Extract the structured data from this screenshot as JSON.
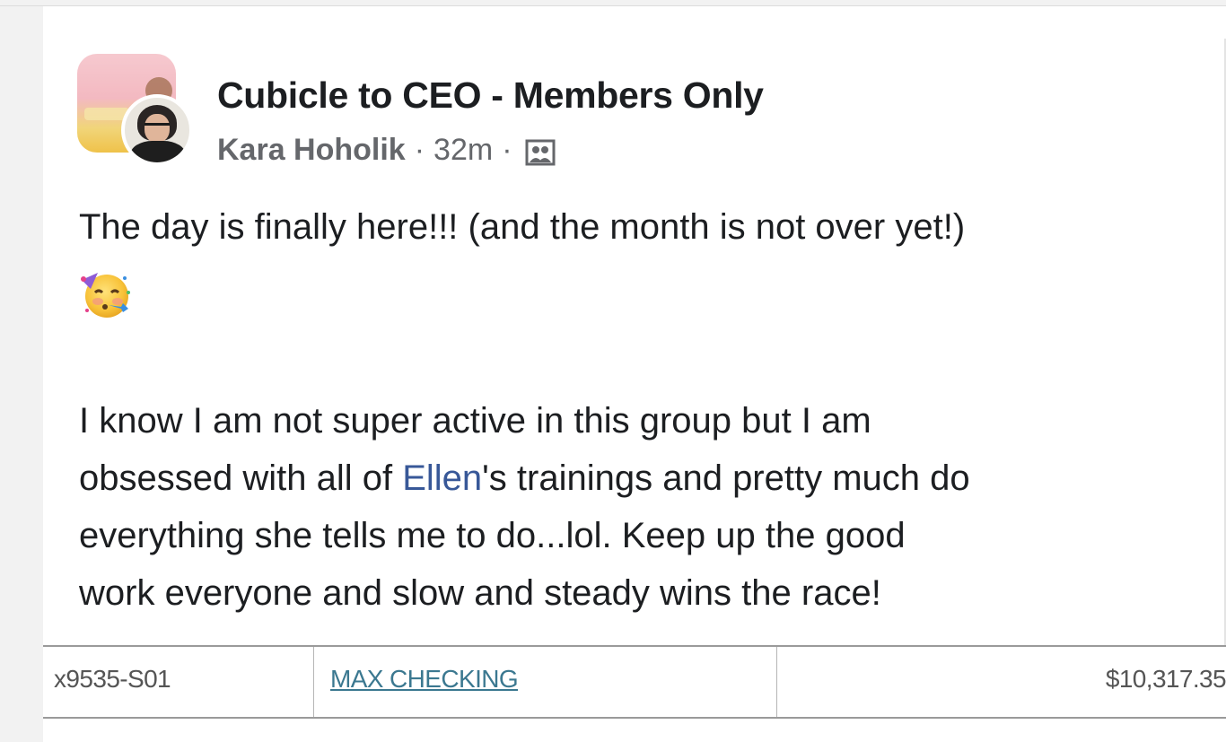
{
  "post": {
    "group_name": "Cubicle to CEO - Members Only",
    "author": "Kara Hoholik",
    "separator": "·",
    "time": "32m",
    "audience_icon": "members-icon",
    "line1": "The day is finally here!!! (and the month is not over yet!)",
    "emoji": "partying-face-emoji",
    "para2_lines": [
      {
        "before": "I know I am not super active in this group but I am",
        "mention": "",
        "after": ""
      },
      {
        "before": "obsessed with all of ",
        "mention": "Ellen",
        "after": "'s trainings and pretty much do"
      },
      {
        "before": "everything she tells me to do...lol. Keep up the good",
        "mention": "",
        "after": ""
      },
      {
        "before": "work everyone and slow and steady wins the race!",
        "mention": "",
        "after": ""
      }
    ]
  },
  "account_row": {
    "account_id": "x9535-S01",
    "account_name": "MAX CHECKING",
    "balance": "$10,317.35"
  },
  "colors": {
    "mention": "#385898",
    "text": "#1c1e21",
    "meta": "#65676b",
    "account_link": "#3b7890"
  }
}
